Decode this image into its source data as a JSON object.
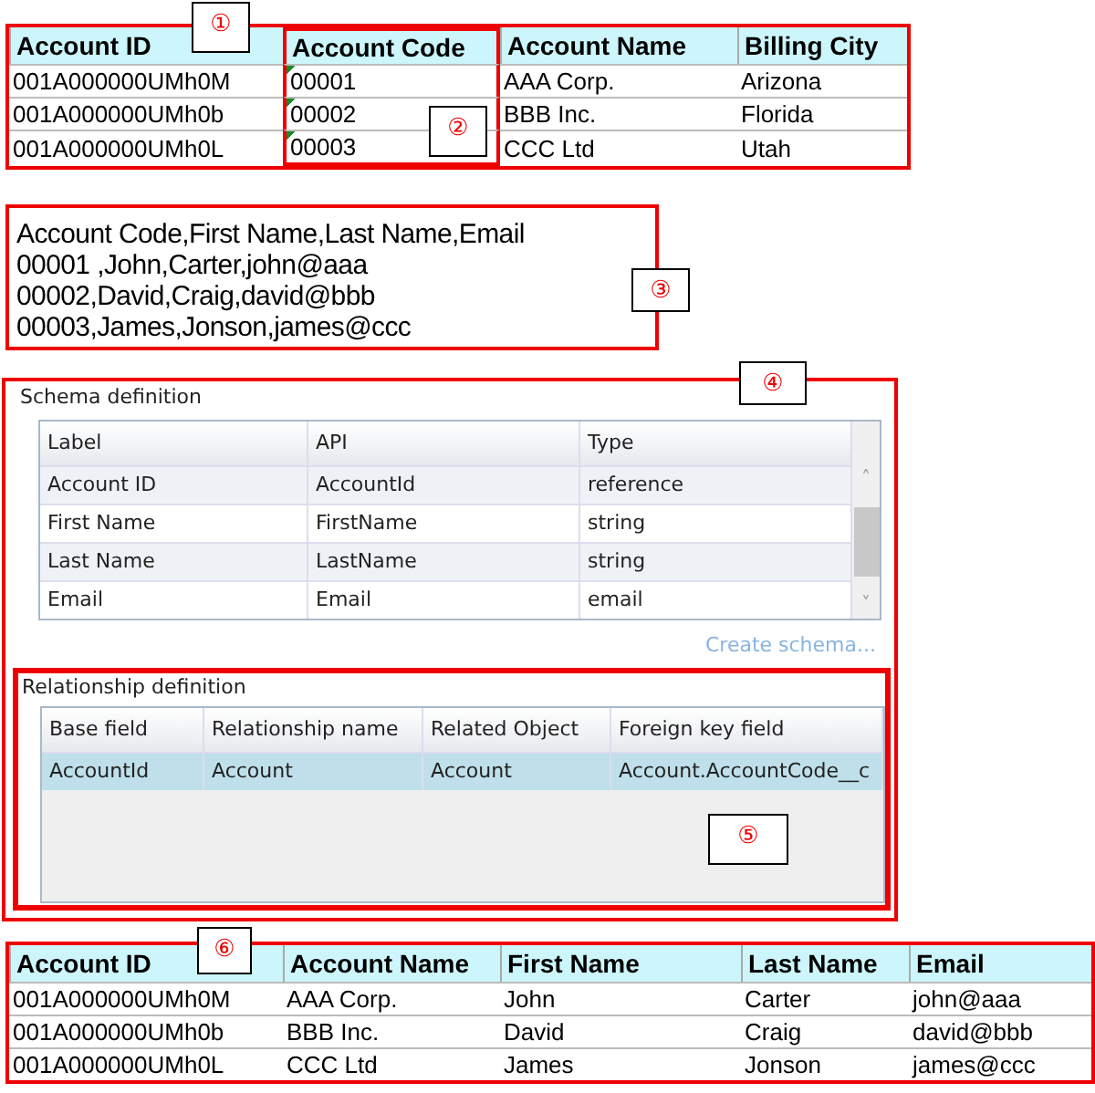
{
  "accounts_table": {
    "callout": "①",
    "columns": [
      {
        "label": "Account ID",
        "flagged": false,
        "highlighted": false
      },
      {
        "label": "Account Code",
        "flagged": true,
        "highlighted": true
      },
      {
        "label": "Account Name",
        "flagged": false,
        "highlighted": false
      },
      {
        "label": "Billing City",
        "flagged": false,
        "highlighted": false
      }
    ],
    "rows": [
      [
        "001A000000UMh0M",
        "00001",
        "AAA Corp.",
        "Arizona"
      ],
      [
        "001A000000UMh0b",
        "00002",
        "BBB Inc.",
        "Florida"
      ],
      [
        "001A000000UMh0L",
        "00003",
        "CCC Ltd",
        "Utah"
      ]
    ],
    "highlight_callout": "②"
  },
  "csv_text": {
    "callout": "③",
    "lines": [
      "Account Code,First Name,Last Name,Email",
      "00001 ,John,Carter,john@aaa",
      "00002,David,Craig,david@bbb",
      "00003,James,Jonson,james@ccc"
    ]
  },
  "schema_panel": {
    "callout": "④",
    "title": "Schema definition",
    "columns": [
      "Label",
      "API",
      "Type"
    ],
    "rows": [
      [
        "Account ID",
        "AccountId",
        "reference"
      ],
      [
        "First Name",
        "FirstName",
        "string"
      ],
      [
        "Last Name",
        "LastName",
        "string"
      ],
      [
        "Email",
        "Email",
        "email"
      ]
    ],
    "scroll_up": "˄",
    "scroll_down": "˅",
    "link": "Create schema..."
  },
  "relationship_panel": {
    "callout": "⑤",
    "title": "Relationship definition",
    "columns": [
      "Base field",
      "Relationship name",
      "Related Object",
      "Foreign key field"
    ],
    "rows": [
      {
        "cells": [
          "AccountId",
          "Account",
          "Account",
          "Account.AccountCode__c"
        ],
        "selected": true
      }
    ]
  },
  "result_table": {
    "callout": "⑥",
    "columns": [
      "Account ID",
      "Account Name",
      "First Name",
      "Last Name",
      "Email"
    ],
    "rows": [
      [
        "001A000000UMh0M",
        "AAA Corp.",
        "John",
        "Carter",
        "john@aaa"
      ],
      [
        "001A000000UMh0b",
        "BBB Inc.",
        "David",
        "Craig",
        "david@bbb"
      ],
      [
        "001A000000UMh0L",
        "CCC Ltd",
        "James",
        "Jonson",
        "james@ccc"
      ]
    ]
  }
}
